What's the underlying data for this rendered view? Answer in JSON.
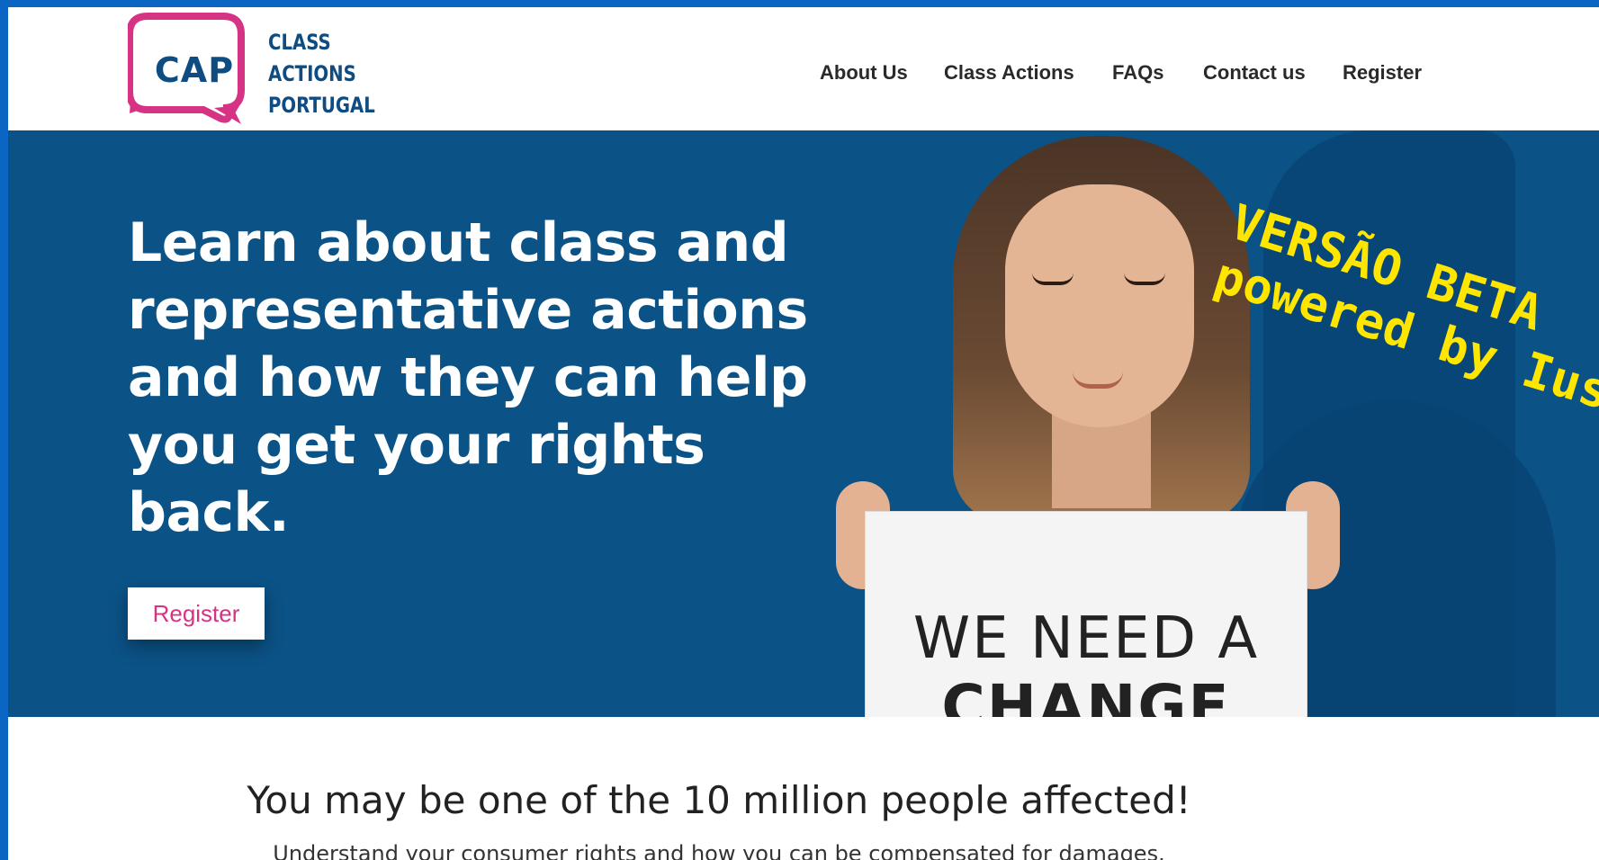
{
  "logo": {
    "badge": "CAP",
    "line1": "CLASS",
    "line2": "ACTIONS",
    "line3": "PORTUGAL"
  },
  "nav": {
    "about": "About Us",
    "class_actions": "Class Actions",
    "faqs": "FAQs",
    "contact": "Contact us",
    "register": "Register"
  },
  "hero": {
    "headline": "Learn about class and representative actions and how they can help you get your rights back.",
    "cta": "Register",
    "sign_line1": "WE NEED A",
    "sign_line2": "CHANGE"
  },
  "overlay": {
    "line1": "VERSÃO BETA",
    "line2": "powered by Ius"
  },
  "section": {
    "title": "You may be one of the 10 million people affected!",
    "subtitle": "Understand your consumer rights and how you can be compensated for damages."
  },
  "colors": {
    "brand_blue": "#0b5286",
    "brand_pink": "#d63384",
    "border_blue": "#0a66c2",
    "beta_yellow": "#ffe600"
  }
}
